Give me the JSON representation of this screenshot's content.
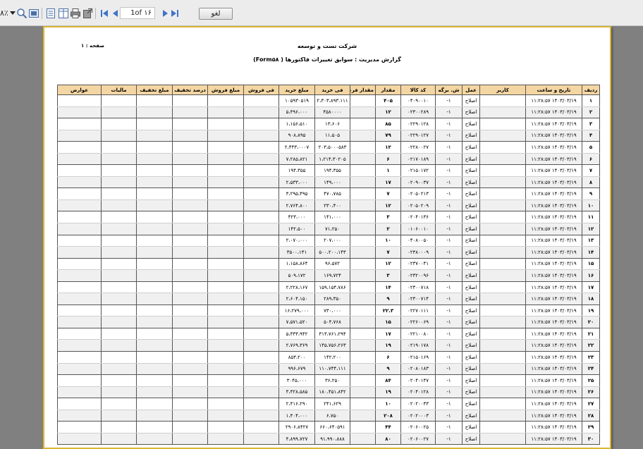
{
  "toolbar": {
    "zoom": "۸٪",
    "page_display": "1of ١۶",
    "cancel_label": "لغو"
  },
  "report": {
    "page_label": "صفحه : ۱",
    "company": "شرکت تست و توسعه",
    "subtitle": "گزارش مدیریت : سوابق تغییرات فاکتورها ( Form۵۸)"
  },
  "table": {
    "headers": [
      "ردیف",
      "تاریخ و ساعت",
      "کاربر",
      "عمل",
      "ش. برگه",
      "کد کالا",
      "مقدار",
      "مقدار فرعی",
      "فی خرید",
      "مبلغ خرید",
      "فی فروش",
      "مبلغ فروش",
      "درصد تخفیف",
      "مبلغ تخفیف",
      "مالیات",
      "عوارض"
    ],
    "rows": [
      [
        "۱",
        "۱۴۰۳/۰۳/۱۹ ۱۱:۲۸:۵۷",
        "",
        "اصلاح",
        "۱-",
        "۰۴۰۹۰۰۱۰",
        "۴۰۵",
        "",
        "۲،۳۰۳،۸۹۳.۱۱۱",
        "۱۰۵۹۳۰۵۱۹",
        "",
        "",
        "",
        "",
        "",
        ""
      ],
      [
        "۲",
        "۱۴۰۳/۰۳/۱۹ ۱۱:۲۸:۵۷",
        "",
        "اصلاح",
        "۱-",
        "۰۲۳۰۰۲۸۹",
        "۱۲",
        "",
        "۴۵۸۰۰۰۰",
        "۵،۴۹۶،۰۰۰",
        "",
        "",
        "",
        "",
        "",
        ""
      ],
      [
        "۳",
        "۱۴۰۳/۰۳/۱۹ ۱۱:۲۸:۵۷",
        "",
        "اصلاح",
        "۱-",
        "۰۲۲۹۰۱۲۸",
        "۸۵",
        "",
        "۱۳،۶۰۶",
        "۱،۱۵۶،۵۱۰",
        "",
        "",
        "",
        "",
        "",
        ""
      ],
      [
        "۴",
        "۱۴۰۳/۰۳/۱۹ ۱۱:۲۸:۵۷",
        "",
        "اصلاح",
        "۱-",
        "۰۲۲۹۰۱۲۷",
        "۷۹",
        "",
        "۱۱،۵۰۵",
        "۹۰۸،۸۹۵",
        "",
        "",
        "",
        "",
        "",
        ""
      ],
      [
        "۵",
        "۱۴۰۳/۰۳/۱۹ ۱۱:۲۸:۵۷",
        "",
        "اصلاح",
        "۱-",
        "۰۲۲۸۰۰۲۷",
        "۱۲",
        "",
        "۲۰۳،۵۰۰۰۵۸۳",
        "۲،۴۴۳،۰۰۰۷",
        "",
        "",
        "",
        "",
        "",
        ""
      ],
      [
        "۶",
        "۱۴۰۳/۰۳/۱۹ ۱۱:۲۸:۵۷",
        "",
        "اصلاح",
        "۱-",
        "۰۲۱۷۰۱۸۹",
        "۶",
        "",
        "۱،۲۱۴،۳۰۲۰۵",
        "۷،۲۸۵،۸۲۱",
        "",
        "",
        "",
        "",
        "",
        ""
      ],
      [
        "۷",
        "۱۴۰۳/۰۳/۱۹ ۱۱:۲۸:۵۷",
        "",
        "اصلاح",
        "۱-",
        "۰۲۱۵۰۱۷۲",
        "۱",
        "",
        "۱۹۴،۳۵۵",
        "۱۹۴،۳۵۵",
        "",
        "",
        "",
        "",
        "",
        ""
      ],
      [
        "۸",
        "۱۴۰۳/۰۳/۱۹ ۱۱:۲۸:۵۷",
        "",
        "اصلاح",
        "۱-",
        "۰۲۰۹۰۰۳۷",
        "۱۷",
        "",
        "۱۴۹،۰۰۰",
        "۲،۵۳۳،۰۰۰",
        "",
        "",
        "",
        "",
        "",
        ""
      ],
      [
        "۹",
        "۱۴۰۳/۰۳/۱۹ ۱۱:۲۸:۵۷",
        "",
        "اصلاح",
        "۱-",
        "۰۲۰۵۰۲۱۳",
        "۷",
        "",
        "۴۷۰،۷۸۵",
        "۳،۲۹۵،۴۹۵",
        "",
        "",
        "",
        "",
        "",
        ""
      ],
      [
        "۱۰",
        "۱۴۰۳/۰۳/۱۹ ۱۱:۲۸:۵۷",
        "",
        "اصلاح",
        "۱-",
        "۰۲۰۵۰۲۰۹",
        "۱۲",
        "",
        "۲۳۰،۴۰۰",
        "۲،۷۶۴،۸۰۰",
        "",
        "",
        "",
        "",
        "",
        ""
      ],
      [
        "۱۱",
        "۱۴۰۳/۰۳/۱۹ ۱۱:۲۸:۵۷",
        "",
        "اصلاح",
        "۱-",
        "۰۲۰۴۰۱۳۶",
        "۳",
        "",
        "۱۴۱،۰۰۰",
        "۴۲۳،۰۰۰",
        "",
        "",
        "",
        "",
        "",
        ""
      ],
      [
        "۱۲",
        "۱۴۰۳/۰۳/۱۹ ۱۱:۲۸:۵۷",
        "",
        "اصلاح",
        "۱-",
        "۰۱۰۶۰۰۱۰",
        "۲",
        "",
        "۷۱،۲۵۰",
        "۱۴۲،۵۰۰",
        "",
        "",
        "",
        "",
        "",
        ""
      ],
      [
        "۱۳",
        "۱۴۰۳/۰۳/۱۹ ۱۱:۲۸:۵۷",
        "",
        "اصلاح",
        "۱-",
        "۰۴۰۸۰۰۵۰",
        "۱۰",
        "",
        "۲۰۷،۰۰۰",
        "۲،۰۷۰،۰۰۰",
        "",
        "",
        "",
        "",
        "",
        ""
      ],
      [
        "۱۴",
        "۱۴۰۳/۰۳/۱۹ ۱۱:۲۸:۵۷",
        "",
        "اصلاح",
        "۱-",
        "۰۲۳۸۰۰۰۹",
        "۷",
        "",
        "۵۰۰،۲۰۰،۱۴۳",
        "۳۵۰۰،۱۴۱",
        "",
        "",
        "",
        "",
        "",
        ""
      ],
      [
        "۱۵",
        "۱۴۰۳/۰۳/۱۹ ۱۱:۲۸:۵۷",
        "",
        "اصلاح",
        "۱-",
        "۰۲۳۷۰۰۴۱",
        "۱۲",
        "",
        "۹۶،۵۷۲",
        "۱،۱۵۸،۸۶۴",
        "",
        "",
        "",
        "",
        "",
        ""
      ],
      [
        "۱۶",
        "۱۴۰۳/۰۳/۱۹ ۱۱:۲۸:۵۷",
        "",
        "اصلاح",
        "۱-",
        "۰۲۳۲۰۰۹۶",
        "۳",
        "",
        "۱۶۹،۷۲۴",
        "۵۰۹،۱۷۲",
        "",
        "",
        "",
        "",
        "",
        ""
      ],
      [
        "۱۷",
        "۱۴۰۳/۰۳/۱۹ ۱۱:۲۸:۵۷",
        "",
        "اصلاح",
        "۱-",
        "۰۲۳۰۰۷۱۸",
        "۱۴",
        "",
        "۱۵۹،۱۵۴،۷۸۶",
        "۲،۲۲۸،۱۶۷",
        "",
        "",
        "",
        "",
        "",
        ""
      ],
      [
        "۱۸",
        "۱۴۰۳/۰۳/۱۹ ۱۱:۲۸:۵۷",
        "",
        "اصلاح",
        "۱-",
        "۰۲۳۰۰۷۱۴",
        "۹",
        "",
        "۲۸۹،۳۵۰",
        "۲،۶۰۴،۱۵۰",
        "",
        "",
        "",
        "",
        "",
        ""
      ],
      [
        "۱۹",
        "۱۴۰۳/۰۳/۱۹ ۱۱:۲۸:۵۷",
        "",
        "اصلاح",
        "۱-",
        "۰۲۲۷۰۱۱۱",
        "۲۲.۳",
        "",
        "۷۳۰،۰۰۰",
        "۱۶،۲۷۹،۰۰۰",
        "",
        "",
        "",
        "",
        "",
        ""
      ],
      [
        "۲۰",
        "۱۴۰۳/۰۳/۱۹ ۱۱:۲۸:۵۷",
        "",
        "اصلاح",
        "۱-",
        "۰۲۲۶۰۰۶۹",
        "۱۵",
        "",
        "۵۰۴،۷۶۸",
        "۷،۵۷۱،۵۲۰",
        "",
        "",
        "",
        "",
        "",
        ""
      ],
      [
        "۲۱",
        "۱۴۰۳/۰۳/۱۹ ۱۱:۲۸:۵۷",
        "",
        "اصلاح",
        "۱-",
        "۰۲۲۱۰۰۸۰",
        "۱۷",
        "",
        "۳۱۳،۷۶۱،۲۹۴",
        "۵،۳۳۳،۹۴۲",
        "",
        "",
        "",
        "",
        "",
        ""
      ],
      [
        "۲۲",
        "۱۴۰۳/۰۳/۱۹ ۱۱:۲۸:۵۷",
        "",
        "اصلاح",
        "۱-",
        "۰۲۱۹۰۱۷۸",
        "۱۹",
        "",
        "۱۴۵،۷۵۶،۲۶۳",
        "۲،۷۶۹،۳۶۹",
        "",
        "",
        "",
        "",
        "",
        ""
      ],
      [
        "۲۳",
        "۱۴۰۳/۰۳/۱۹ ۱۱:۲۸:۵۷",
        "",
        "اصلاح",
        "۱-",
        "۰۲۱۵۰۱۶۹",
        "۶",
        "",
        "۱۴۲،۲۰۰",
        "۸۵۳،۲۰۰",
        "",
        "",
        "",
        "",
        "",
        ""
      ],
      [
        "۲۴",
        "۱۴۰۳/۰۳/۱۹ ۱۱:۲۸:۵۷",
        "",
        "اصلاح",
        "۱-",
        "۰۲۰۸۰۱۸۳",
        "۹",
        "",
        "۱۱۰،۷۴۴،۱۱۱",
        "۹۹۶،۶۷۹",
        "",
        "",
        "",
        "",
        "",
        ""
      ],
      [
        "۲۵",
        "۱۴۰۳/۰۳/۱۹ ۱۱:۲۸:۵۷",
        "",
        "اصلاح",
        "۱-",
        "۰۲۰۴۰۱۴۷",
        "۸۴",
        "",
        "۳۶،۲۵۰",
        "۳۰۴۵،۰۰۰",
        "",
        "",
        "",
        "",
        "",
        ""
      ],
      [
        "۲۶",
        "۱۴۰۳/۰۳/۱۹ ۱۱:۲۸:۵۷",
        "",
        "اصلاح",
        "۱-",
        "۰۲۰۴۰۱۲۸",
        "۱۹",
        "",
        "۱۸۰،۴۵۱،۸۴۲",
        "۳،۴۲۸،۵۸۵",
        "",
        "",
        "",
        "",
        "",
        ""
      ],
      [
        "۲۷",
        "۱۴۰۳/۰۳/۱۹ ۱۱:۲۸:۵۷",
        "",
        "اصلاح",
        "۱-",
        "۰۲۰۲۰۰۴۳",
        "۱۰",
        "",
        "۲۴۱،۶۲۹",
        "۲،۴۱۶،۲۹۰",
        "",
        "",
        "",
        "",
        "",
        ""
      ],
      [
        "۲۸",
        "۱۴۰۳/۰۳/۱۹ ۱۱:۲۸:۵۷",
        "",
        "اصلاح",
        "۱-",
        "۰۲۰۲۰۰۰۳",
        "۲۰۸",
        "",
        "۶،۷۵۰",
        "۱،۴۰۴،۰۰۰",
        "",
        "",
        "",
        "",
        "",
        ""
      ],
      [
        "۲۹",
        "۱۴۰۳/۰۳/۱۹ ۱۱:۲۸:۵۷",
        "",
        "اصلاح",
        "۱-",
        "۰۲۰۶۰۰۲۵",
        "۴۴",
        "",
        "۶۶۰،۶۴۰۵۹۱",
        "۲۹۰۶،۸۴۲۷",
        "",
        "",
        "",
        "",
        "",
        ""
      ],
      [
        "۳۰",
        "۱۴۰۳/۰۳/۱۹ ۱۱:۲۸:۵۷",
        "",
        "اصلاح",
        "۱-",
        "۰۲۰۶۰۰۲۷",
        "۸۰",
        "",
        "۹۱،۹۹۰،۸۸۸",
        "۴،۸۹۹،۷۲۷",
        "",
        "",
        "",
        "",
        "",
        ""
      ]
    ]
  }
}
